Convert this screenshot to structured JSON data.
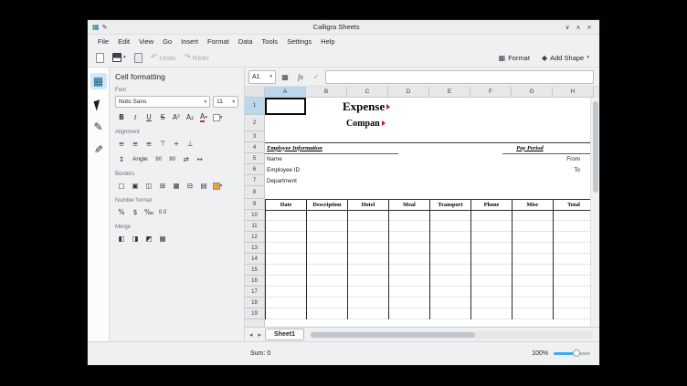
{
  "window": {
    "title": "Calligra Sheets",
    "minimize": "∨",
    "maximize": "∧",
    "close": "×"
  },
  "menu": [
    "File",
    "Edit",
    "View",
    "Go",
    "Insert",
    "Format",
    "Data",
    "Tools",
    "Settings",
    "Help"
  ],
  "toolbar": {
    "undo_icon": "↶",
    "undo_label": "Undo",
    "redo_icon": "↷",
    "redo_label": "Redo",
    "format_icon": "▦",
    "format_label": "Format",
    "add_shape_icon": "◆",
    "add_shape_label": "Add Shape",
    "dropdown": "▾"
  },
  "formula_bar": {
    "cell_ref": "A1",
    "range_icon": "▦",
    "fx": "fx",
    "apply": "✓",
    "input_value": ""
  },
  "docker": {
    "title": "Cell formatting",
    "font_section": "Font",
    "font_family": "Noto Sans",
    "font_size": "11",
    "alignment_section": "Alignment",
    "angle_label": "Angle",
    "borders_section": "Borders",
    "number_section": "Number format",
    "merge_section": "Merge"
  },
  "icons": {
    "bold": "B",
    "italic": "I",
    "underline": "U",
    "strikethrough": "S",
    "superscript": "A²",
    "subscript": "A₂",
    "text_color": "A",
    "dropdown": "▾",
    "align_left": "≡",
    "align_center": "≡",
    "align_right": "≡",
    "valign_top": "⊤",
    "valign_middle": "+",
    "valign_bottom": "⊥",
    "vertical_text": "↕",
    "rotate_ccw": "90",
    "rotate_cw": "90",
    "indent_less": "⇄",
    "indent_more": "↔",
    "borders": [
      "▢",
      "▣",
      "◫",
      "⊞",
      "▦",
      "⊟",
      "▤"
    ],
    "number": [
      "%",
      "$",
      "‰",
      "0.0"
    ],
    "merge": [
      "◧",
      "◨",
      "◩",
      "▦"
    ],
    "nav_left": "◂",
    "nav_right": "▸"
  },
  "sheet": {
    "columns": [
      "A",
      "B",
      "C",
      "D",
      "E",
      "F",
      "G",
      "H"
    ],
    "row_numbers": [
      "1",
      "2",
      "3",
      "4",
      "5",
      "6",
      "7",
      "8",
      "9",
      "10",
      "11",
      "12",
      "13",
      "14",
      "15",
      "16",
      "17",
      "18",
      "19"
    ],
    "title": "Expense",
    "subtitle": "Compan",
    "employee_information": "Employee Information",
    "pay_period": "Pay Period",
    "name_label": "Name",
    "from_label": "From",
    "employee_id_label": "Employee ID",
    "to_label": "To",
    "department_label": "Department",
    "table_headers": [
      "Date",
      "Description",
      "Hotel",
      "Meal",
      "Transport",
      "Phone",
      "Misc",
      "Total"
    ]
  },
  "sheet_tabs": [
    "Sheet1"
  ],
  "status": {
    "sum": "Sum: 0",
    "zoom": "100%"
  },
  "colors": {
    "accent": "#3daee9",
    "selected_header": "#b9d8ee",
    "overflow_marker": "#cc1414"
  }
}
